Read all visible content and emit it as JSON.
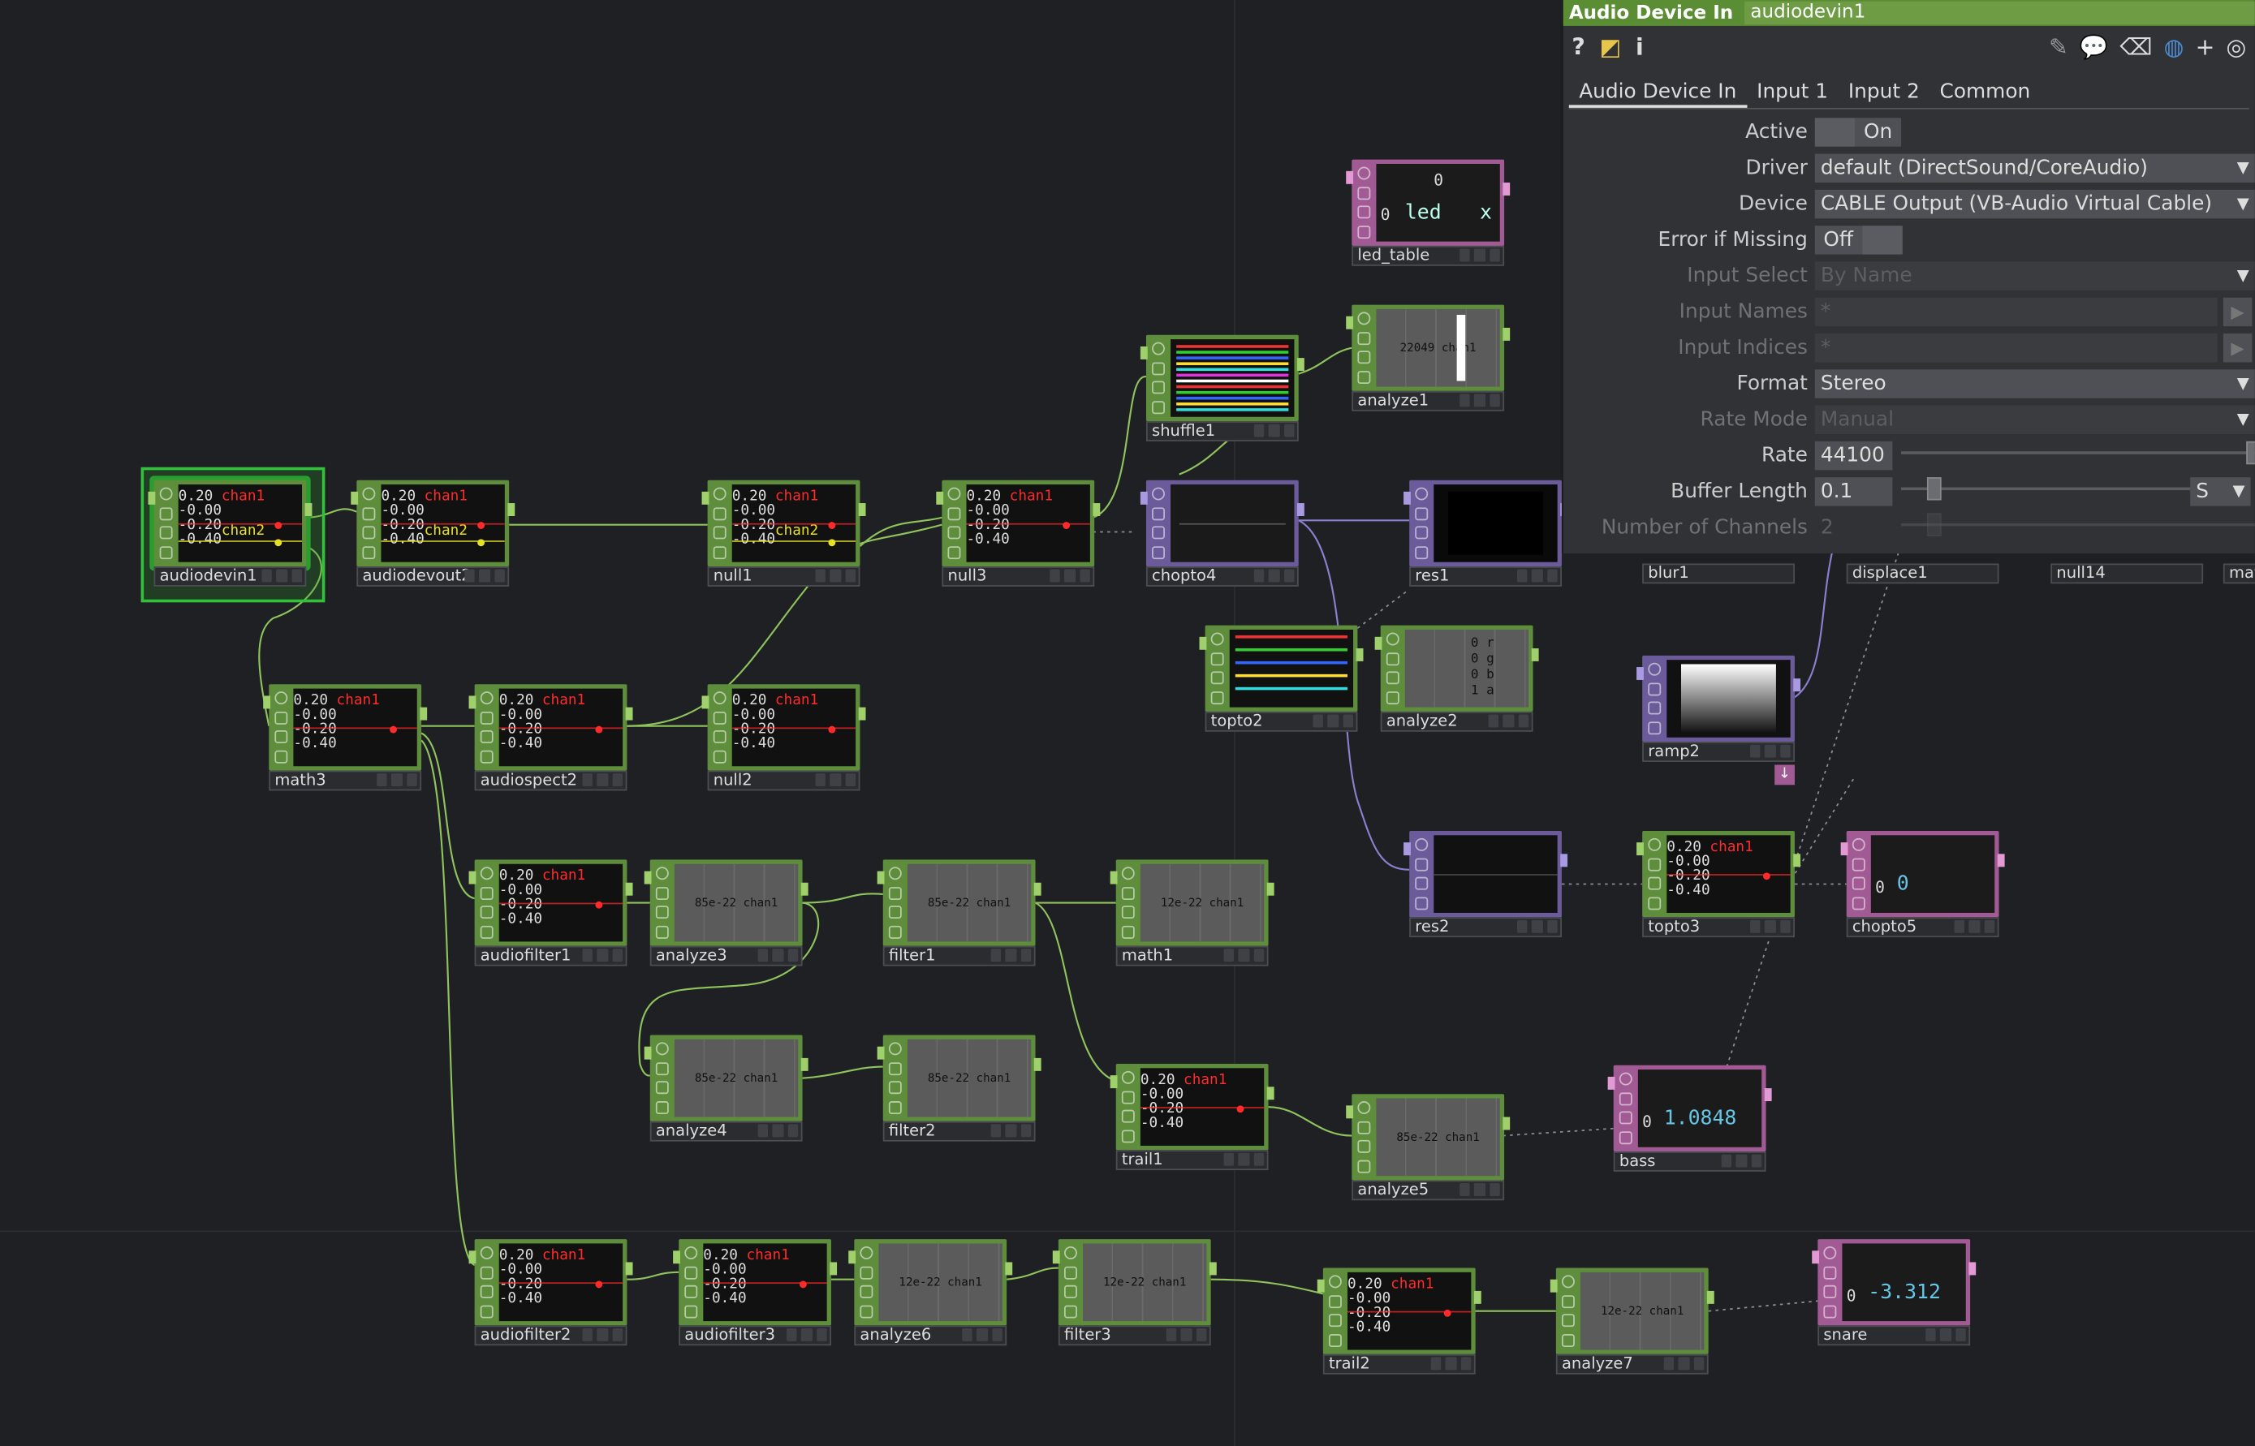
{
  "panel": {
    "op_type": "Audio Device In",
    "op_name": "audiodevin1",
    "tabs": [
      "Audio Device In",
      "Input 1",
      "Input 2",
      "Common"
    ],
    "params": [
      {
        "label": "Active",
        "value": "On",
        "kind": "toggle",
        "disabled": false
      },
      {
        "label": "Driver",
        "value": "default (DirectSound/CoreAudio)",
        "kind": "menu",
        "disabled": false
      },
      {
        "label": "Device",
        "value": "CABLE Output (VB-Audio Virtual Cable)",
        "kind": "menu",
        "disabled": false
      },
      {
        "label": "Error if Missing",
        "value": "Off",
        "kind": "toggle",
        "disabled": false
      },
      {
        "label": "Input Select",
        "value": "By Name",
        "kind": "menu",
        "disabled": true
      },
      {
        "label": "Input Names",
        "value": "*",
        "kind": "text",
        "disabled": true
      },
      {
        "label": "Input Indices",
        "value": "*",
        "kind": "text",
        "disabled": true
      },
      {
        "label": "Format",
        "value": "Stereo",
        "kind": "menu",
        "disabled": false
      },
      {
        "label": "Rate Mode",
        "value": "Manual",
        "kind": "menu",
        "disabled": true
      },
      {
        "label": "Rate",
        "value": "44100",
        "kind": "slider",
        "disabled": false
      },
      {
        "label": "Buffer Length",
        "value": "0.1",
        "kind": "slider",
        "unit": "S",
        "disabled": false
      },
      {
        "label": "Number of Channels",
        "value": "2",
        "kind": "slider",
        "disabled": true
      }
    ]
  },
  "node_labels": {
    "audiodevin1": "audiodevin1",
    "audiodevout2": "audiodevout2",
    "null1": "null1",
    "null3": "null3",
    "chopto4": "chopto4",
    "shuffle1": "shuffle1",
    "analyze1": "analyze1",
    "led_table": "led_table",
    "res1": "res1",
    "blur1": "blur1",
    "displace1": "displace1",
    "null14": "null14",
    "mat": "mat",
    "math3": "math3",
    "audiospect2": "audiospect2",
    "null2": "null2",
    "topto2": "topto2",
    "analyze2": "analyze2",
    "ramp2": "ramp2",
    "audiofilter1": "audiofilter1",
    "analyze3": "analyze3",
    "filter1": "filter1",
    "math1": "math1",
    "res2": "res2",
    "topto3": "topto3",
    "chopto5": "chopto5",
    "analyze4": "analyze4",
    "filter2": "filter2",
    "trail1": "trail1",
    "analyze5": "analyze5",
    "bass": "bass",
    "audiofilter2": "audiofilter2",
    "audiofilter3": "audiofilter3",
    "analyze6": "analyze6",
    "filter3": "filter3",
    "trail2": "trail2",
    "analyze7": "analyze7",
    "snare": "snare"
  },
  "viewer_text": {
    "chan1": "chan1",
    "chan2": "chan2",
    "ticks4": "0.20\n-0.00\n-0.20\n-0.40",
    "ticks3": "0.40\n0.40\n0.40",
    "analyze1": "22049 chan1",
    "analyze_85": "85e-22 chan1",
    "analyze_12": "12e-22 chan1",
    "led_table_hdr": "0",
    "led_table_row_idx": "0",
    "led_table_val": "led",
    "led_table_x": "x",
    "analyze2_rows": [
      "0 r",
      "0 g",
      "0 b",
      "1 a"
    ],
    "chopto5_idx": "0",
    "chopto5_val": "0",
    "bass_idx": "0",
    "bass_val": "1.0848",
    "snare_idx": "0",
    "snare_val": "-3.312"
  }
}
